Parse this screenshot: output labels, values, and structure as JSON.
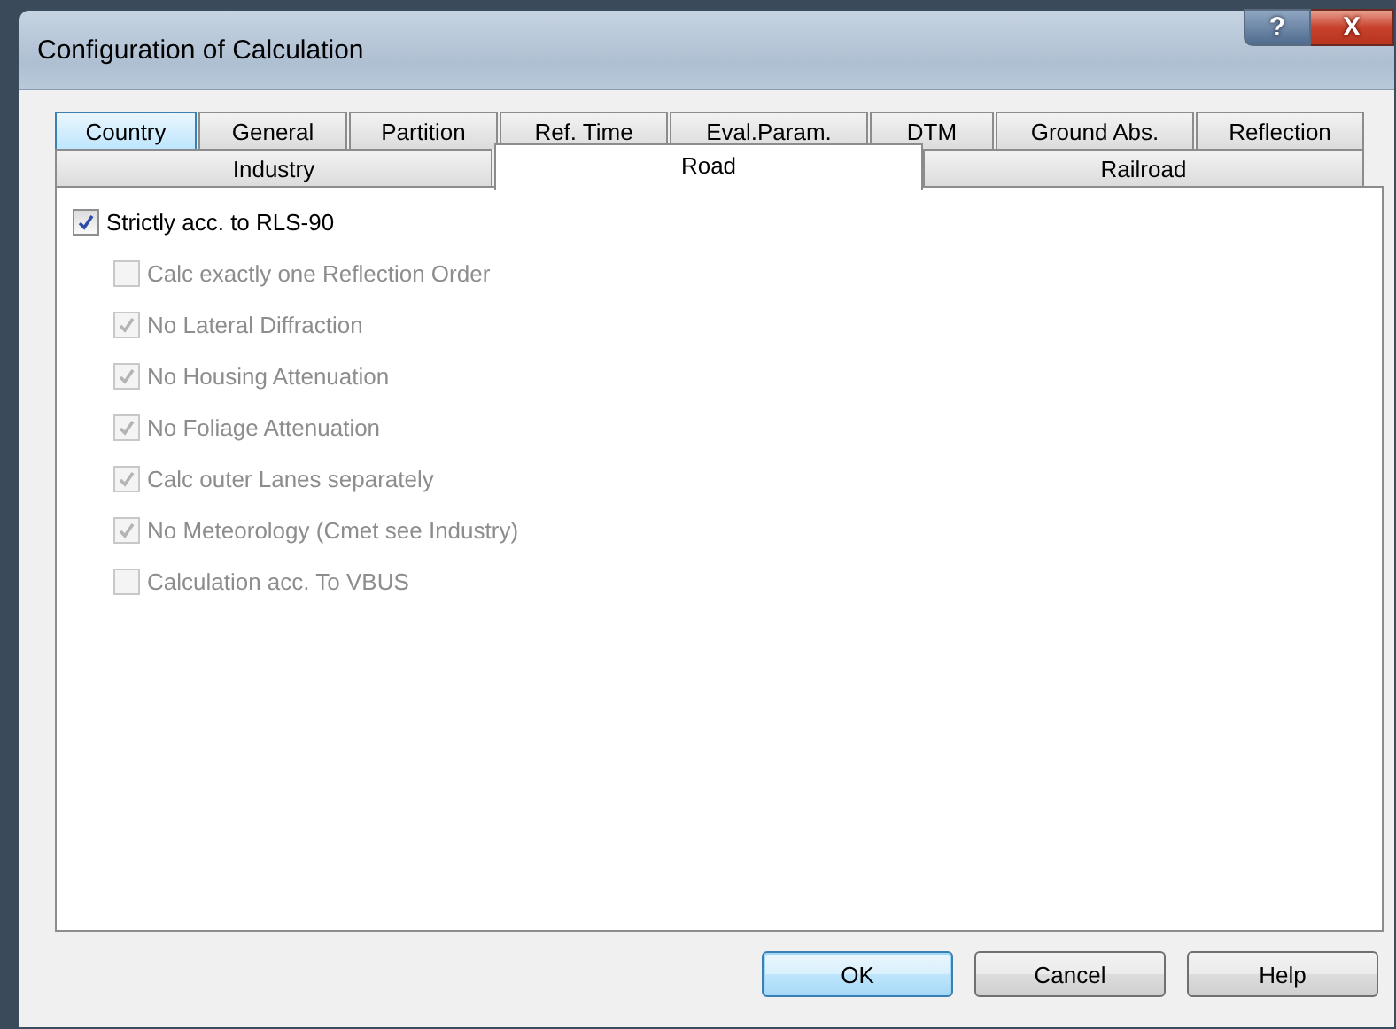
{
  "window": {
    "title": "Configuration of Calculation",
    "help_button": "?",
    "close_button": "X"
  },
  "tab_rows": [
    {
      "tabs": [
        {
          "label": "Country",
          "selected": false,
          "hovered": true
        },
        {
          "label": "General",
          "selected": false,
          "hovered": false
        },
        {
          "label": "Partition",
          "selected": false,
          "hovered": false
        },
        {
          "label": "Ref. Time",
          "selected": false,
          "hovered": false
        },
        {
          "label": "Eval.Param.",
          "selected": false,
          "hovered": false
        },
        {
          "label": "DTM",
          "selected": false,
          "hovered": false
        },
        {
          "label": "Ground Abs.",
          "selected": false,
          "hovered": false
        },
        {
          "label": "Reflection",
          "selected": false,
          "hovered": false
        }
      ]
    },
    {
      "tabs": [
        {
          "label": "Industry",
          "selected": false,
          "hovered": false
        },
        {
          "label": "Road",
          "selected": true,
          "hovered": false
        },
        {
          "label": "Railroad",
          "selected": false,
          "hovered": false
        }
      ]
    }
  ],
  "options": [
    {
      "label": "Strictly acc. to RLS-90",
      "checked": true,
      "disabled": false,
      "children": [
        {
          "label": "Calc exactly one Reflection Order",
          "checked": false,
          "disabled": true
        },
        {
          "label": "No Lateral Diffraction",
          "checked": true,
          "disabled": true
        },
        {
          "label": "No Housing Attenuation",
          "checked": true,
          "disabled": true
        },
        {
          "label": "No Foliage Attenuation",
          "checked": true,
          "disabled": true
        },
        {
          "label": "Calc outer Lanes separately",
          "checked": true,
          "disabled": true
        },
        {
          "label": "No Meteorology (Cmet see Industry)",
          "checked": true,
          "disabled": true
        },
        {
          "label": "Calculation acc. To VBUS",
          "checked": false,
          "disabled": true
        }
      ]
    }
  ],
  "buttons": [
    {
      "label": "OK",
      "default": true
    },
    {
      "label": "Cancel",
      "default": false
    },
    {
      "label": "Help",
      "default": false
    }
  ]
}
